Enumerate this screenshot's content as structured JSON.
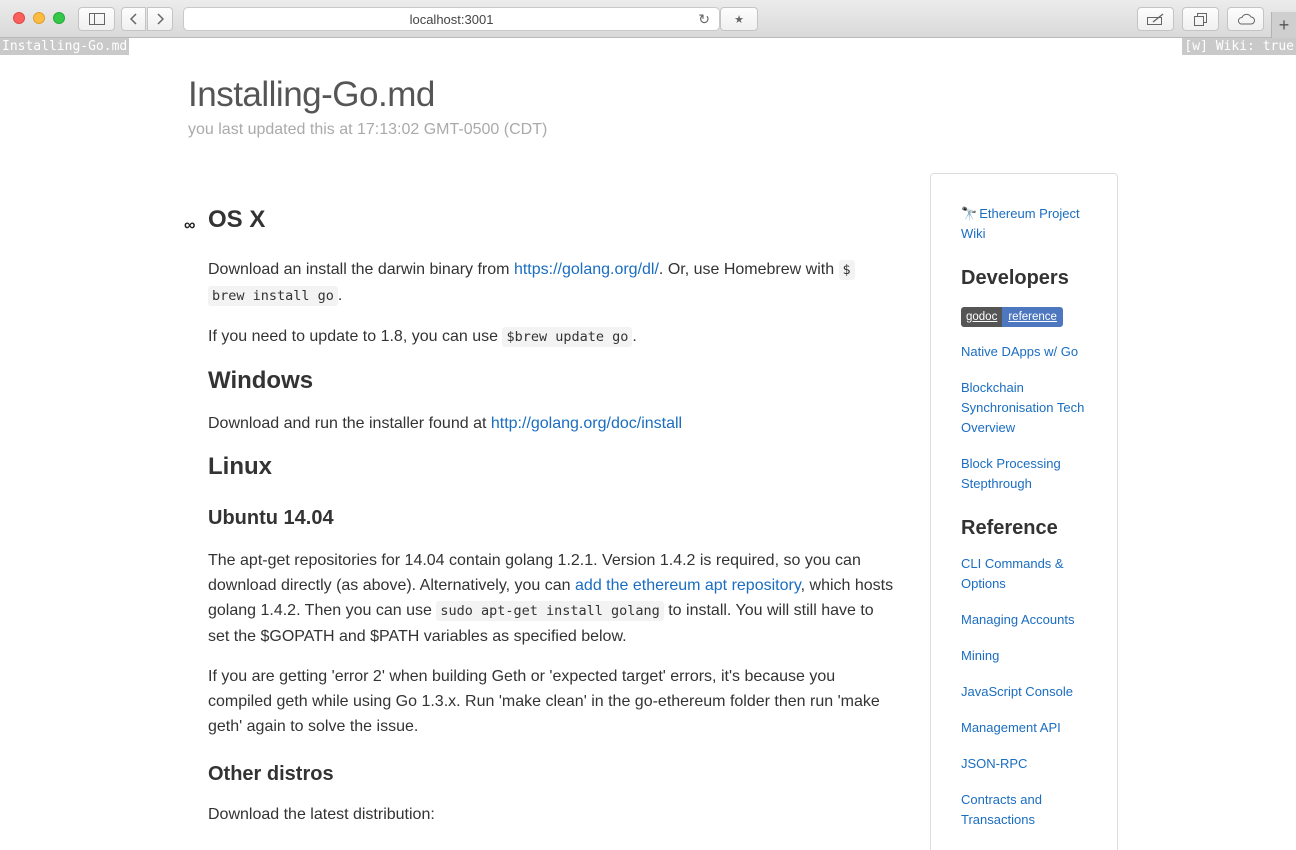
{
  "browser": {
    "url": "localhost:3001"
  },
  "status": {
    "left": "Installing-Go.md",
    "right": "[w] Wiki: true"
  },
  "page": {
    "title": "Installing-Go.md",
    "subtitle": "you last updated this at 17:13:02 GMT-0500 (CDT)"
  },
  "content": {
    "h_osx": "OS X",
    "osx_p1_a": "Download an install the darwin binary from ",
    "osx_p1_link": "https://golang.org/dl/",
    "osx_p1_b": ". Or, use Homebrew with ",
    "osx_p1_code1": "$",
    "osx_p1_code2": "brew install go",
    "osx_p1_c": ".",
    "osx_p2_a": "If you need to update to 1.8, you can use ",
    "osx_p2_code": "$brew update go",
    "osx_p2_b": ".",
    "h_windows": "Windows",
    "win_p_a": "Download and run the installer found at ",
    "win_p_link": "http://golang.org/doc/install",
    "h_linux": "Linux",
    "h_ubuntu": "Ubuntu 14.04",
    "ub_p1_a": "The apt-get repositories for 14.04 contain golang 1.2.1. Version 1.4.2 is required, so you can download directly (as above). Alternatively, you can ",
    "ub_p1_link": "add the ethereum apt repository",
    "ub_p1_b": ", which hosts golang 1.4.2. Then you can use ",
    "ub_p1_code": "sudo apt-get install golang",
    "ub_p1_c": " to install. You will still have to set the $GOPATH and $PATH variables as specified below.",
    "ub_p2": "If you are getting 'error 2' when building Geth or 'expected target' errors, it's because you compiled geth while using Go 1.3.x. Run 'make clean' in the go-ethereum folder then run 'make geth' again to solve the issue.",
    "h_other": "Other distros",
    "other_p": "Download the latest distribution:"
  },
  "sidebar": {
    "wiki_link": "Ethereum Project Wiki",
    "developers_heading": "Developers",
    "badge_left": "godoc",
    "badge_right": "reference",
    "dev_links": [
      "Native DApps w/ Go",
      "Blockchain Synchronisation Tech Overview",
      "Block Processing Stepthrough"
    ],
    "reference_heading": "Reference",
    "ref_links": [
      "CLI Commands & Options",
      "Managing Accounts",
      "Mining",
      "JavaScript Console",
      "Management API",
      "JSON-RPC",
      "Contracts and Transactions"
    ]
  },
  "icons": {
    "sidebar_toggle": "sidebar-icon",
    "back": "chevron-left-icon",
    "forward": "chevron-right-icon",
    "reload": "reload-icon",
    "favorites": "star-icon",
    "share": "pen-icon",
    "tabs": "tabs-icon",
    "cloud": "cloud-icon",
    "anchor": "link-icon",
    "wiki": "telescope-icon"
  }
}
